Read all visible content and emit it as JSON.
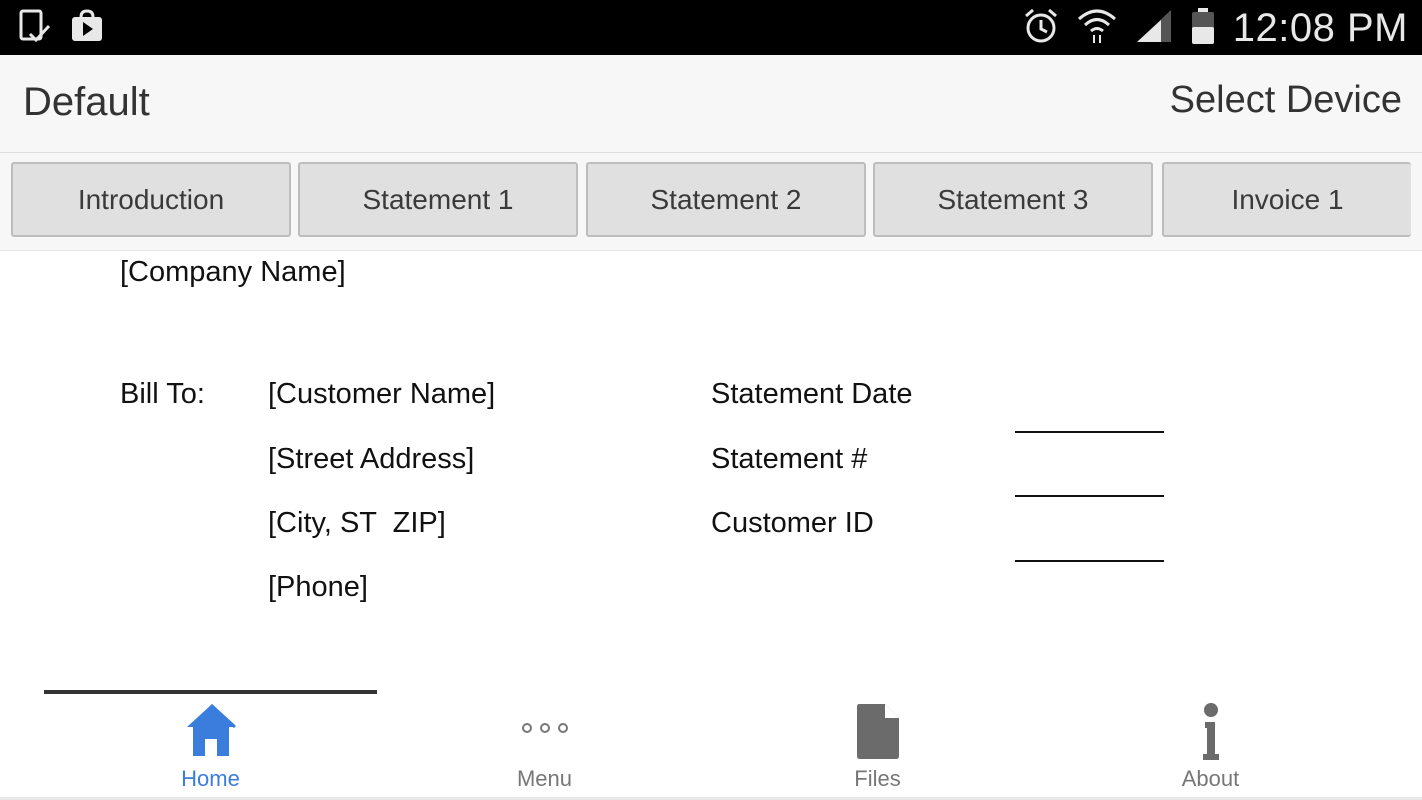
{
  "status_bar": {
    "time": "12:08 PM",
    "icons_left": [
      "phone-check-icon",
      "shopping-bag-play-icon"
    ],
    "icons_right": [
      "alarm-icon",
      "wifi-icon",
      "signal-icon",
      "battery-icon"
    ]
  },
  "header": {
    "title": "Default",
    "select_device": "Select Device"
  },
  "tabs": [
    {
      "label": "Introduction"
    },
    {
      "label": "Statement 1"
    },
    {
      "label": "Statement 2"
    },
    {
      "label": "Statement 3"
    },
    {
      "label": "Invoice 1"
    }
  ],
  "document": {
    "company_name": "[Company Name]",
    "bill_to_label": "Bill To:",
    "customer_name": "[Customer Name]",
    "street_address": "[Street Address]",
    "city_st_zip": "[City, ST  ZIP]",
    "phone": "[Phone]",
    "statement_date_label": "Statement Date",
    "statement_number_label": "Statement #",
    "customer_id_label": "Customer ID"
  },
  "bottom_nav": {
    "items": [
      {
        "label": "Home",
        "icon": "home-icon",
        "active": true
      },
      {
        "label": "Menu",
        "icon": "more-dots-icon",
        "active": false
      },
      {
        "label": "Files",
        "icon": "file-icon",
        "active": false
      },
      {
        "label": "About",
        "icon": "info-icon",
        "active": false
      }
    ]
  },
  "colors": {
    "status_bar_bg": "#000000",
    "header_bg": "#f7f7f7",
    "tab_bg": "#e0e0e0",
    "active_nav": "#3b7ddd",
    "inactive_nav": "#777777"
  }
}
